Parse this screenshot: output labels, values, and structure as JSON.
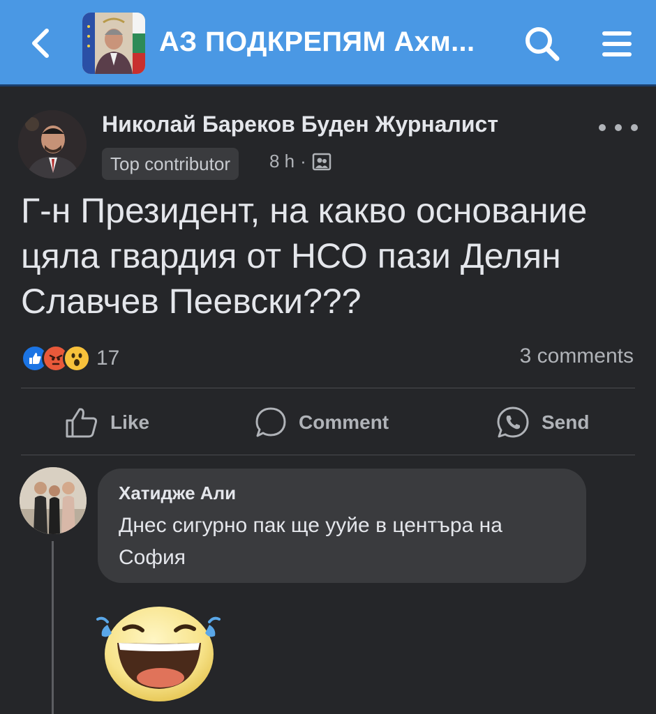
{
  "header": {
    "title": "АЗ ПОДКРЕПЯМ Ахм...",
    "back_icon": "chevron-left-icon",
    "search_icon": "search-icon",
    "menu_icon": "hamburger-menu-icon",
    "bg_color": "#4a98e4"
  },
  "post": {
    "author": "Николай Бареков Буден Журналист",
    "badge": "Top contributor",
    "time": "8 h",
    "separator": "·",
    "audience_icon": "group-audience-icon",
    "text": "Г-н Президент, на какво основание цяла гвардия от НСО пази Делян Славчев Пеевски???",
    "reactions": {
      "icons": [
        "like-reaction-icon",
        "angry-reaction-icon",
        "wow-reaction-icon"
      ],
      "count": "17"
    },
    "comments_count": "3 comments"
  },
  "actions": {
    "like": "Like",
    "comment": "Comment",
    "send": "Send"
  },
  "comment": {
    "author": "Хатидже Али",
    "text": "Днес сигурно пак ще ууйе в центъра на София",
    "sticker_icon": "laughing-tears-emoji-icon"
  }
}
